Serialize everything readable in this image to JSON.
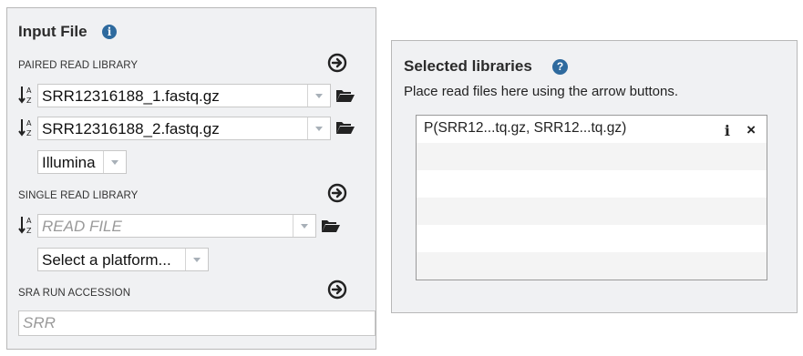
{
  "input_file": {
    "title": "Input File",
    "info_icon": "i",
    "paired": {
      "label": "PAIRED READ LIBRARY",
      "read1": "SRR12316188_1.fastq.gz",
      "read2": "SRR12316188_2.fastq.gz",
      "platform": "Illumina"
    },
    "single": {
      "label": "SINGLE READ LIBRARY",
      "read_placeholder": "READ FILE",
      "platform_value": "Select a platform..."
    },
    "sra": {
      "label": "SRA RUN ACCESSION",
      "placeholder": "SRR"
    }
  },
  "selected": {
    "title": "Selected libraries",
    "help_icon": "?",
    "subtitle": "Place read files here using the arrow buttons.",
    "items": [
      {
        "label": "P(SRR12...tq.gz, SRR12...tq.gz)",
        "info": "i",
        "close": "×"
      }
    ]
  },
  "icons": {
    "add": "arrow-circle-right-icon",
    "sort": "sort-alpha-down-icon",
    "folder": "folder-open-icon"
  },
  "colors": {
    "accent": "#2e6a9e",
    "panel": "#f0f1f3"
  }
}
